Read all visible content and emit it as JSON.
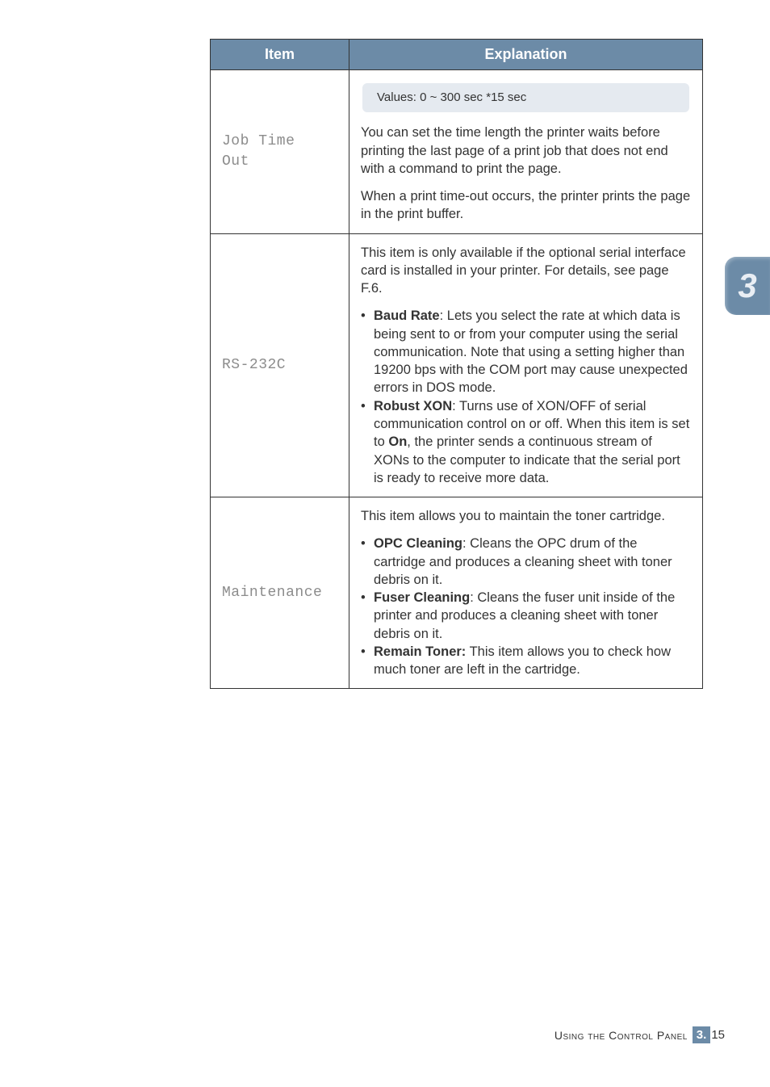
{
  "sideTab": "3",
  "table": {
    "headers": {
      "item": "Item",
      "explanation": "Explanation"
    },
    "rows": [
      {
        "label": "Job Time\nOut",
        "valuesBox": "Values: 0 ~ 300 sec     *15 sec",
        "p1": "You can set the time length the printer waits before printing the last page of a print job that does not end with a command to print the page.",
        "p2": "When a print time-out occurs, the printer prints the page in the print buffer."
      },
      {
        "label": "RS-232C",
        "intro": "This item is only available if the optional serial interface card is installed in your printer. For details, see page F.6.",
        "b1_label": "Baud Rate",
        "b1_text": ": Lets you select the rate at which data is being sent to or from your computer using the serial communication. Note that using a setting higher than 19200 bps with the COM port may cause unexpected errors in DOS mode.",
        "b2_label": "Robust XON",
        "b2_text_a": ": Turns use of XON/OFF of serial communication control on or off. When this item is set to ",
        "b2_on": "On",
        "b2_text_b": ", the printer sends a continuous stream of XONs to the computer to indicate that the serial port is ready to receive more data."
      },
      {
        "label": "Maintenance",
        "intro": "This item allows you to maintain the toner cartridge.",
        "b1_label": "OPC Cleaning",
        "b1_text": ": Cleans the OPC drum of the cartridge and produces a cleaning sheet with toner debris on it.",
        "b2_label": "Fuser Cleaning",
        "b2_text": ": Cleans the fuser unit inside of the printer and produces a cleaning sheet with toner debris on it.",
        "b3_label": "Remain Toner:",
        "b3_text": " This item allows you to check how much toner are left in the cartridge."
      }
    ]
  },
  "footer": {
    "text": "Using the Control Panel",
    "chapter": "3.",
    "page": "15"
  }
}
